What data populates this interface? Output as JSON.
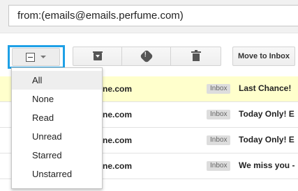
{
  "search": {
    "value": "from:(emails@emails.perfume.com)"
  },
  "toolbar": {
    "move_label": "Move to Inbox",
    "icons": {
      "archive": "archive-icon",
      "spam": "report-spam-icon",
      "delete": "trash-icon"
    }
  },
  "select_menu": {
    "items": [
      {
        "label": "All"
      },
      {
        "label": "None"
      },
      {
        "label": "Read"
      },
      {
        "label": "Unread"
      },
      {
        "label": "Starred"
      },
      {
        "label": "Unstarred"
      }
    ]
  },
  "emails": [
    {
      "sender": "ne.com",
      "badge": "Inbox",
      "subject": "Last Chance!",
      "highlight": true
    },
    {
      "sender": "ne.com",
      "badge": "Inbox",
      "subject": "Today Only! E",
      "highlight": false
    },
    {
      "sender": "ne.com",
      "badge": "Inbox",
      "subject": "Today Only! E",
      "highlight": false
    },
    {
      "sender": "ne.com",
      "badge": "Inbox",
      "subject": "We miss you -",
      "highlight": false
    }
  ],
  "colors": {
    "focus_outline": "#1ea0e6",
    "highlight_row": "#ffffcc",
    "label_badge_bg": "#dddddd"
  }
}
